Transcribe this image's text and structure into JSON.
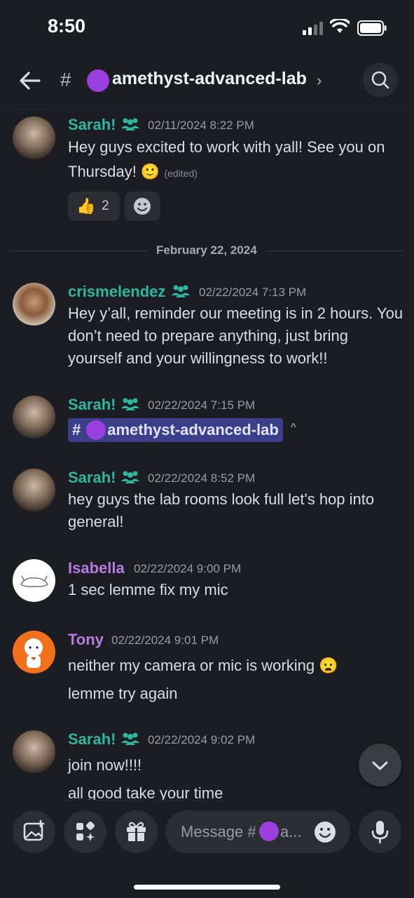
{
  "status": {
    "time": "8:50"
  },
  "header": {
    "channel_title": "amethyst-advanced-lab",
    "chevron": "›"
  },
  "date_divider": "February 22, 2024",
  "messages": [
    {
      "user": "Sarah!",
      "time": "02/11/2024 8:22 PM",
      "text1": "Hey guys excited to work with yall! See you on",
      "text2": "Thursday! 🙂",
      "edited": "(edited)",
      "reactions": [
        {
          "emoji": "👍",
          "count": "2"
        }
      ]
    },
    {
      "user": "crismelendez",
      "time": "02/22/2024 7:13 PM",
      "text": "Hey y’all, reminder our meeting is in 2 hours. You don’t need to prepare anything, just bring yourself and your willingness to work!!"
    },
    {
      "user": "Sarah!",
      "time": "02/22/2024 7:15 PM",
      "mention": "amethyst-advanced-lab",
      "mention_hash": "#",
      "caret": "^"
    },
    {
      "user": "Sarah!",
      "time": "02/22/2024 8:52 PM",
      "text": "hey guys the lab rooms look full let's hop into general!"
    },
    {
      "user": "Isabella",
      "time": "02/22/2024 9:00 PM",
      "text": "1 sec lemme fix my mic"
    },
    {
      "user": "Tony",
      "time": "02/22/2024 9:01 PM",
      "text1": "neither my camera or mic is working 😦",
      "text2": "lemme try again"
    },
    {
      "user": "Sarah!",
      "time": "02/22/2024 9:02 PM",
      "text1": "join now!!!!",
      "text2": "all good take your time"
    }
  ],
  "composer": {
    "placeholder_prefix": "Message #",
    "placeholder_suffix": "a..."
  },
  "colors": {
    "background": "#1c1d22",
    "teal_name": "#2fb6a1",
    "purple_name": "#b57be0",
    "mention_bg": "#3b3f8a",
    "channel_dot": "#9b3fe0"
  }
}
